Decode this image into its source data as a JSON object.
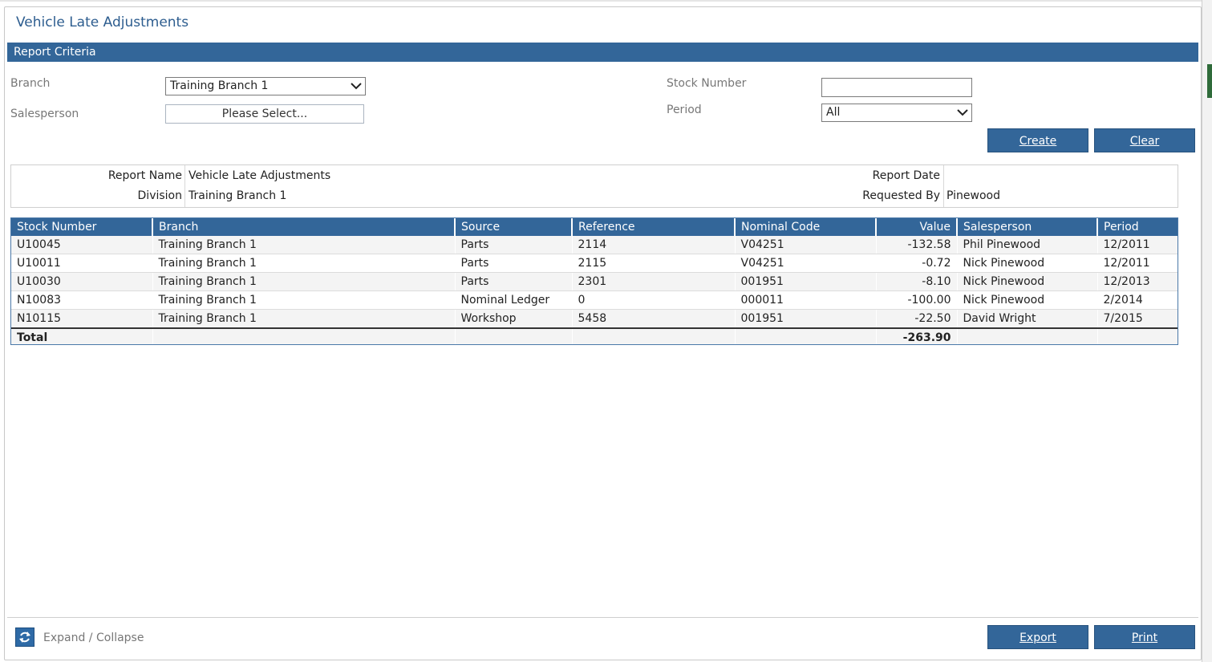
{
  "page": {
    "title": "Vehicle Late Adjustments"
  },
  "criteria": {
    "section_title": "Report Criteria",
    "branch_label": "Branch",
    "branch_value": "Training Branch 1",
    "salesperson_label": "Salesperson",
    "salesperson_button": "Please Select...",
    "stock_number_label": "Stock Number",
    "stock_number_value": "",
    "period_label": "Period",
    "period_value": "All",
    "create_label": "Create",
    "clear_label": "Clear"
  },
  "report_info": {
    "report_name_label": "Report Name",
    "report_name_value": "Vehicle Late Adjustments",
    "division_label": "Division",
    "division_value": "Training Branch 1",
    "report_date_label": "Report Date",
    "report_date_value": "",
    "requested_by_label": "Requested By",
    "requested_by_value": "Pinewood"
  },
  "table": {
    "headers": [
      "Stock Number",
      "Branch",
      "Source",
      "Reference",
      "Nominal Code",
      "Value",
      "Salesperson",
      "Period"
    ],
    "rows": [
      [
        "U10045",
        "Training Branch 1",
        "Parts",
        "2114",
        "V04251",
        "-132.58",
        "Phil Pinewood",
        "12/2011"
      ],
      [
        "U10011",
        "Training Branch 1",
        "Parts",
        "2115",
        "V04251",
        "-0.72",
        "Nick Pinewood",
        "12/2011"
      ],
      [
        "U10030",
        "Training Branch 1",
        "Parts",
        "2301",
        "001951",
        "-8.10",
        "Nick Pinewood",
        "12/2013"
      ],
      [
        "N10083",
        "Training Branch 1",
        "Nominal Ledger",
        "0",
        "000011",
        "-100.00",
        "Nick Pinewood",
        "2/2014"
      ],
      [
        "N10115",
        "Training Branch 1",
        "Workshop",
        "5458",
        "001951",
        "-22.50",
        "David Wright",
        "7/2015"
      ]
    ],
    "total_label": "Total",
    "total_value": "-263.90"
  },
  "footer": {
    "expand_label": "Expand / Collapse",
    "export_label": "Export",
    "print_label": "Print",
    "refresh_icon": "refresh-icon"
  },
  "colors": {
    "accent": "#336699",
    "title": "#2d5d8f"
  }
}
